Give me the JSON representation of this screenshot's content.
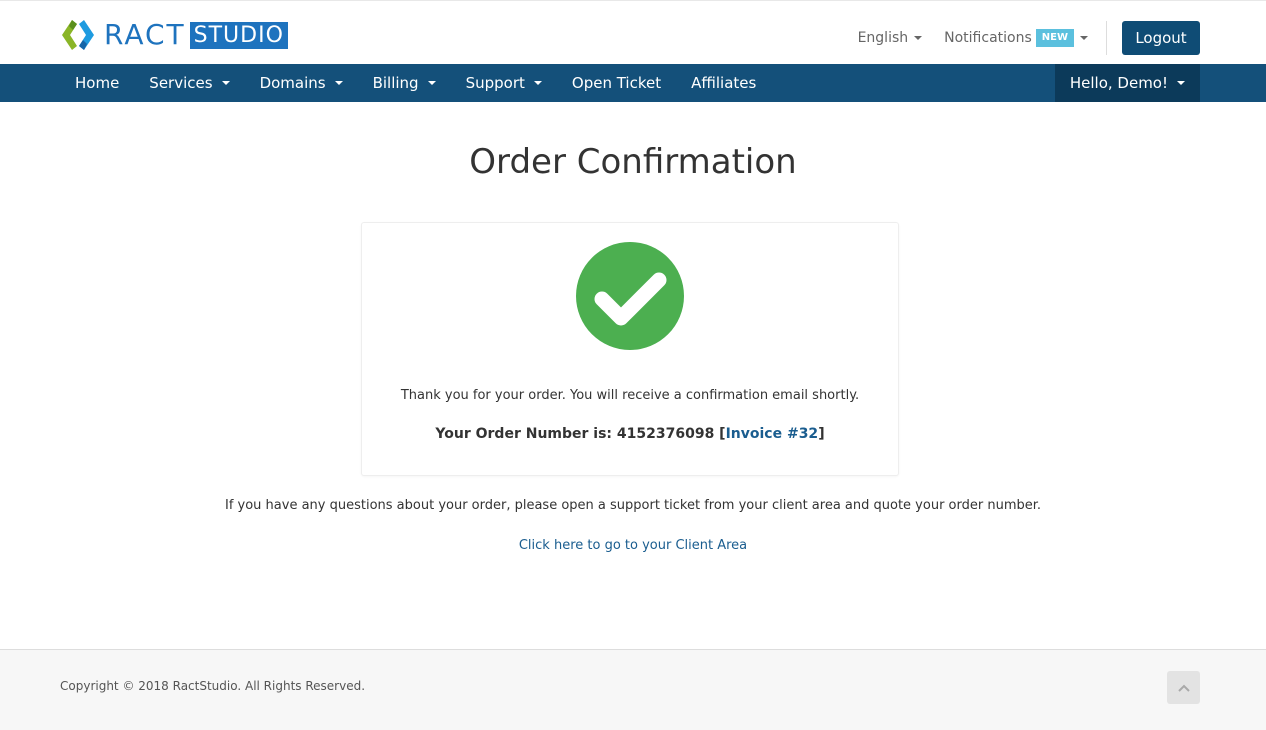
{
  "brand": {
    "name_part1": "RACT",
    "name_part2": "STUDIO"
  },
  "header": {
    "language": "English",
    "notifications_label": "Notifications",
    "notifications_badge": "NEW",
    "logout_label": "Logout"
  },
  "nav": {
    "items": [
      {
        "label": "Home",
        "dropdown": false
      },
      {
        "label": "Services",
        "dropdown": true
      },
      {
        "label": "Domains",
        "dropdown": true
      },
      {
        "label": "Billing",
        "dropdown": true
      },
      {
        "label": "Support",
        "dropdown": true
      },
      {
        "label": "Open Ticket",
        "dropdown": false
      },
      {
        "label": "Affiliates",
        "dropdown": false
      }
    ],
    "user_greeting": "Hello, Demo!"
  },
  "main": {
    "title": "Order Confirmation",
    "status_icon": "check-icon",
    "thanks_text": "Thank you for your order. You will receive a confirmation email shortly.",
    "order_number_prefix": "Your Order Number is: 4152376098 [",
    "invoice_link": "Invoice #32",
    "order_number_suffix": "]",
    "questions_text": "If you have any questions about your order, please open a support ticket from your client area and quote your order number.",
    "client_area_link": "Click here to go to your Client Area"
  },
  "footer": {
    "copyright": "Copyright © 2018 RactStudio. All Rights Reserved.",
    "back_to_top_icon": "chevron-up-icon"
  },
  "colors": {
    "brand_blue": "#1e73be",
    "navbar": "#14507a",
    "navbar_user": "#0c3a5a",
    "logout_button": "#0f4c75",
    "success_green": "#4caf50",
    "badge_new": "#5bc0de",
    "link": "#1a5d8f"
  }
}
